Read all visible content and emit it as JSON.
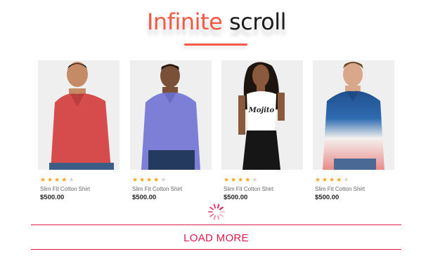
{
  "header": {
    "title_accent": "Infinite",
    "title_rest": "scroll",
    "accent_color": "#f25a45"
  },
  "products": [
    {
      "name": "Slim Fit Cotton Shirt",
      "price": "$500.00",
      "rating": 4,
      "rating_max": 5,
      "shirt_color": "#d64b4b",
      "photo": "man-red-polo"
    },
    {
      "name": "Slim Fit Cotton Shirt",
      "price": "$500.00",
      "rating": 4,
      "rating_max": 5,
      "shirt_color": "#7d7fd6",
      "photo": "man-purple-polo"
    },
    {
      "name": "Slim Fit Cotton Shirt",
      "price": "$500.00",
      "rating": 4,
      "rating_max": 5,
      "shirt_color": "#ffffff",
      "photo": "woman-white-tank"
    },
    {
      "name": "Slim Fit Cotton Shirt",
      "price": "$500.00",
      "rating": 4,
      "rating_max": 5,
      "shirt_color": "#2a5ea0",
      "photo": "man-ombre-polo"
    }
  ],
  "spinner_icon": "loading-spinner-icon",
  "load_more": {
    "label": "LOAD MORE",
    "color": "#e0194d"
  },
  "star_color": "#f6a623"
}
